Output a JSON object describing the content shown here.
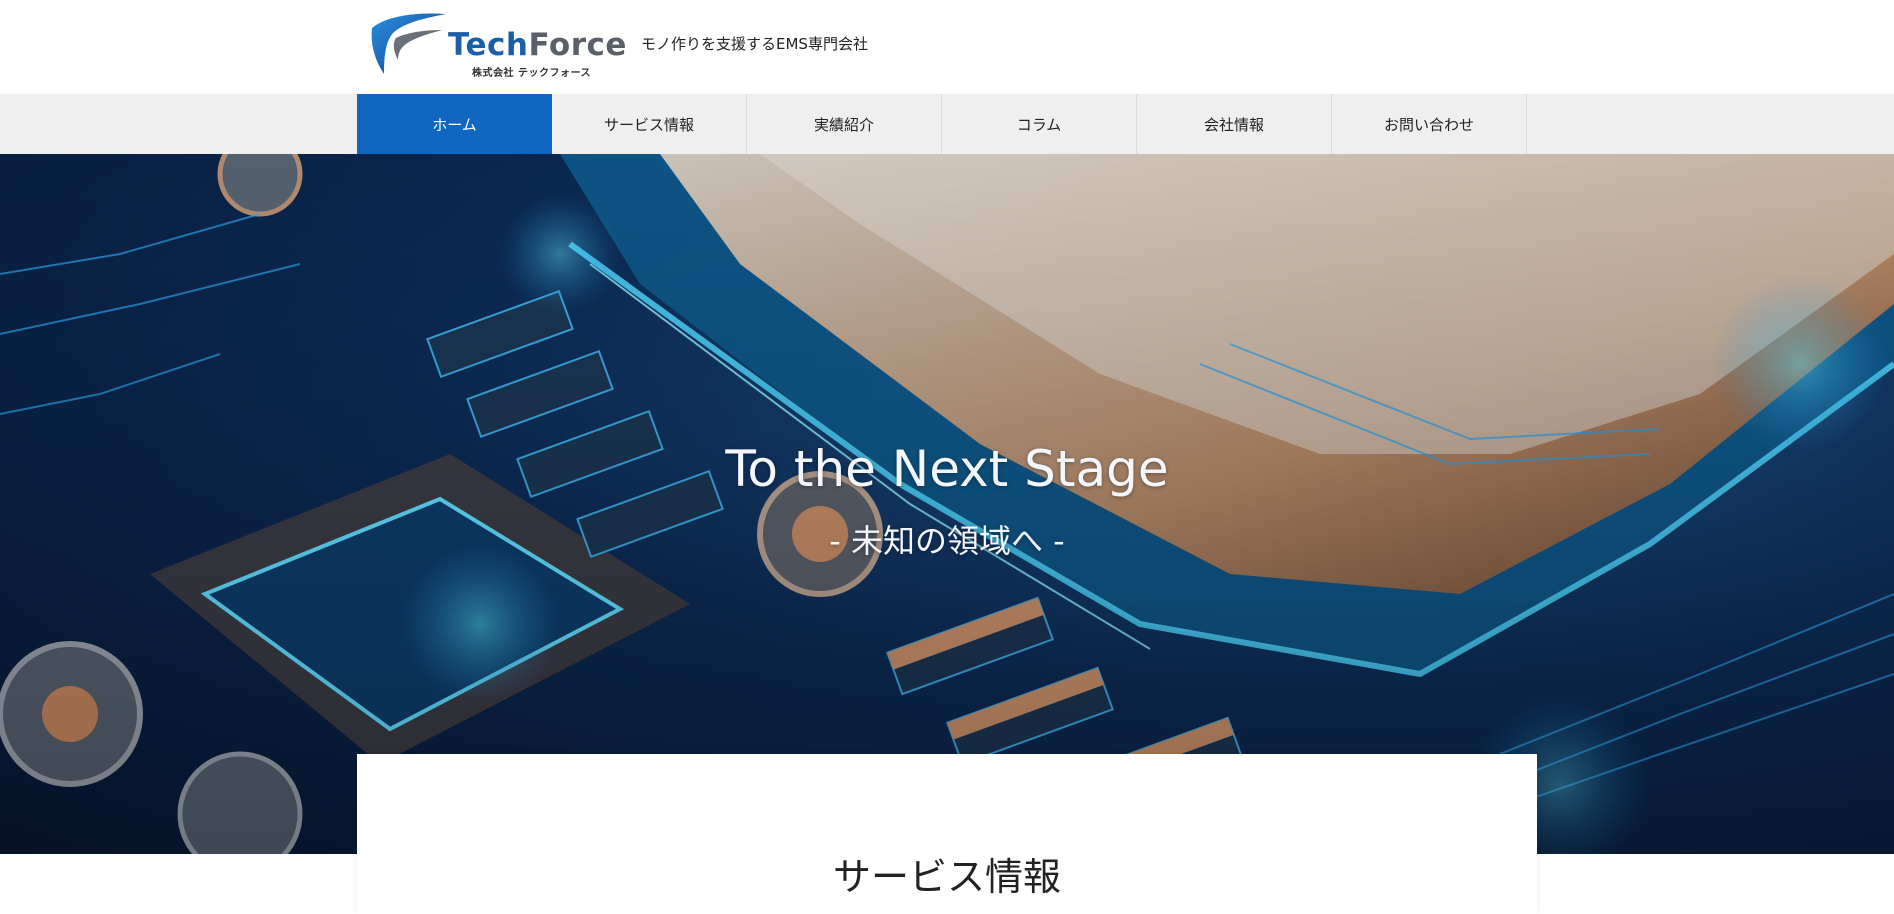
{
  "header": {
    "logo": {
      "brand_tech": "Tech",
      "brand_force": "Force",
      "company_ja": "株式会社 テックフォース"
    },
    "tagline": "モノ作りを支援するEMS専門会社"
  },
  "nav": {
    "items": [
      {
        "label": "ホーム",
        "active": true
      },
      {
        "label": "サービス情報",
        "active": false
      },
      {
        "label": "実績紹介",
        "active": false
      },
      {
        "label": "コラム",
        "active": false
      },
      {
        "label": "会社情報",
        "active": false
      },
      {
        "label": "お問い合わせ",
        "active": false
      }
    ]
  },
  "hero": {
    "title": "To the Next Stage",
    "subtitle": "- 未知の領域へ -"
  },
  "main": {
    "section_title": "サービス情報"
  },
  "colors": {
    "nav_active": "#1166c2",
    "brand_blue": "#1b5fa8",
    "brand_gray": "#5a6068",
    "nav_background": "#efefef"
  }
}
